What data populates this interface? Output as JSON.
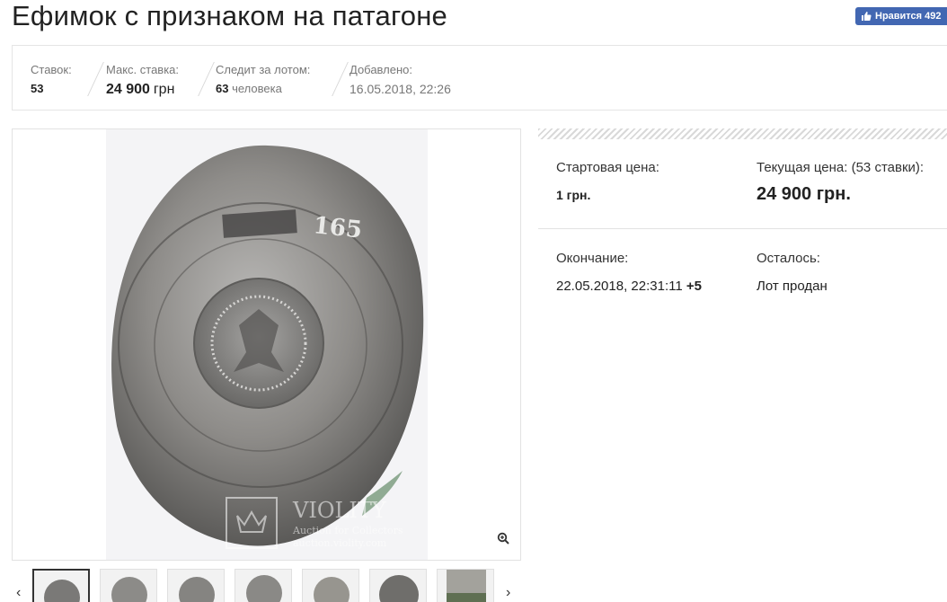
{
  "page": {
    "title": "Ефимок с признаком на патагоне",
    "like_button": "Нравится 492"
  },
  "stats": {
    "bids_label": "Ставок:",
    "bids_value": "53",
    "max_bid_label": "Макс. ставка:",
    "max_bid_value": "24 900",
    "max_bid_currency": "грн",
    "watchers_label": "Следит за лотом:",
    "watchers_value": "63",
    "watchers_unit": "человека",
    "added_label": "Добавлено:",
    "added_value": "16.05.2018, 22:26"
  },
  "gallery": {
    "main_image": "coin-photo",
    "watermark_brand": "VIOLITY",
    "watermark_tagline": "Auction for Collectors",
    "watermark_url": "auction.violity.com",
    "coin_year": "165",
    "thumbnails_count": 7,
    "icons": {
      "zoom": "zoom-in-icon",
      "prev": "chevron-left-icon",
      "next": "chevron-right-icon"
    }
  },
  "lot": {
    "start_price_label": "Стартовая цена:",
    "start_price_value": "1 грн.",
    "current_price_label": "Текущая цена: (53 ставки):",
    "current_price_value": "24 900 грн.",
    "end_label": "Окончание:",
    "end_value": "22.05.2018, 22:31:11",
    "end_tz": "+5",
    "remaining_label": "Осталось:",
    "remaining_value": "Лот продан"
  },
  "colors": {
    "accent": "#4267b2",
    "text": "#222222",
    "muted": "#777777",
    "border": "#e5e5e5"
  }
}
